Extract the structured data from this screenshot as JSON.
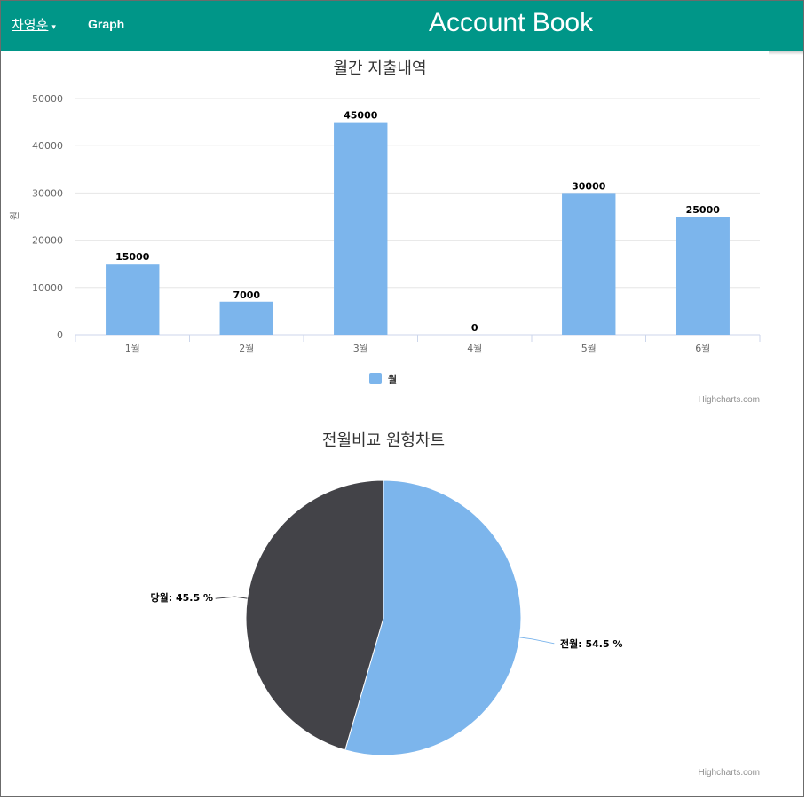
{
  "navbar": {
    "user_label": "차영훈",
    "caret": "▾",
    "graph_label": "Graph",
    "title": "Account Book",
    "bg_color": "#009688"
  },
  "chart_data": [
    {
      "type": "bar",
      "title": "월간 지출내역",
      "ylabel": "원",
      "xlabel": "",
      "categories": [
        "1월",
        "2월",
        "3월",
        "4월",
        "5월",
        "6월"
      ],
      "series": [
        {
          "name": "월",
          "values": [
            15000,
            7000,
            45000,
            0,
            30000,
            25000
          ],
          "color": "#7cb5ec"
        }
      ],
      "ylim": [
        0,
        50000
      ],
      "yticks": [
        0,
        10000,
        20000,
        30000,
        40000,
        50000
      ],
      "grid": true,
      "legend": "bottom-center",
      "credit": "Highcharts.com"
    },
    {
      "type": "pie",
      "title": "전월비교 원형차트",
      "slices": [
        {
          "name": "전월",
          "value": 54.5,
          "label": "전월: 54.5 %",
          "color": "#7cb5ec"
        },
        {
          "name": "당월",
          "value": 45.5,
          "label": "당월: 45.5 %",
          "color": "#434348"
        }
      ],
      "credit": "Highcharts.com"
    }
  ]
}
